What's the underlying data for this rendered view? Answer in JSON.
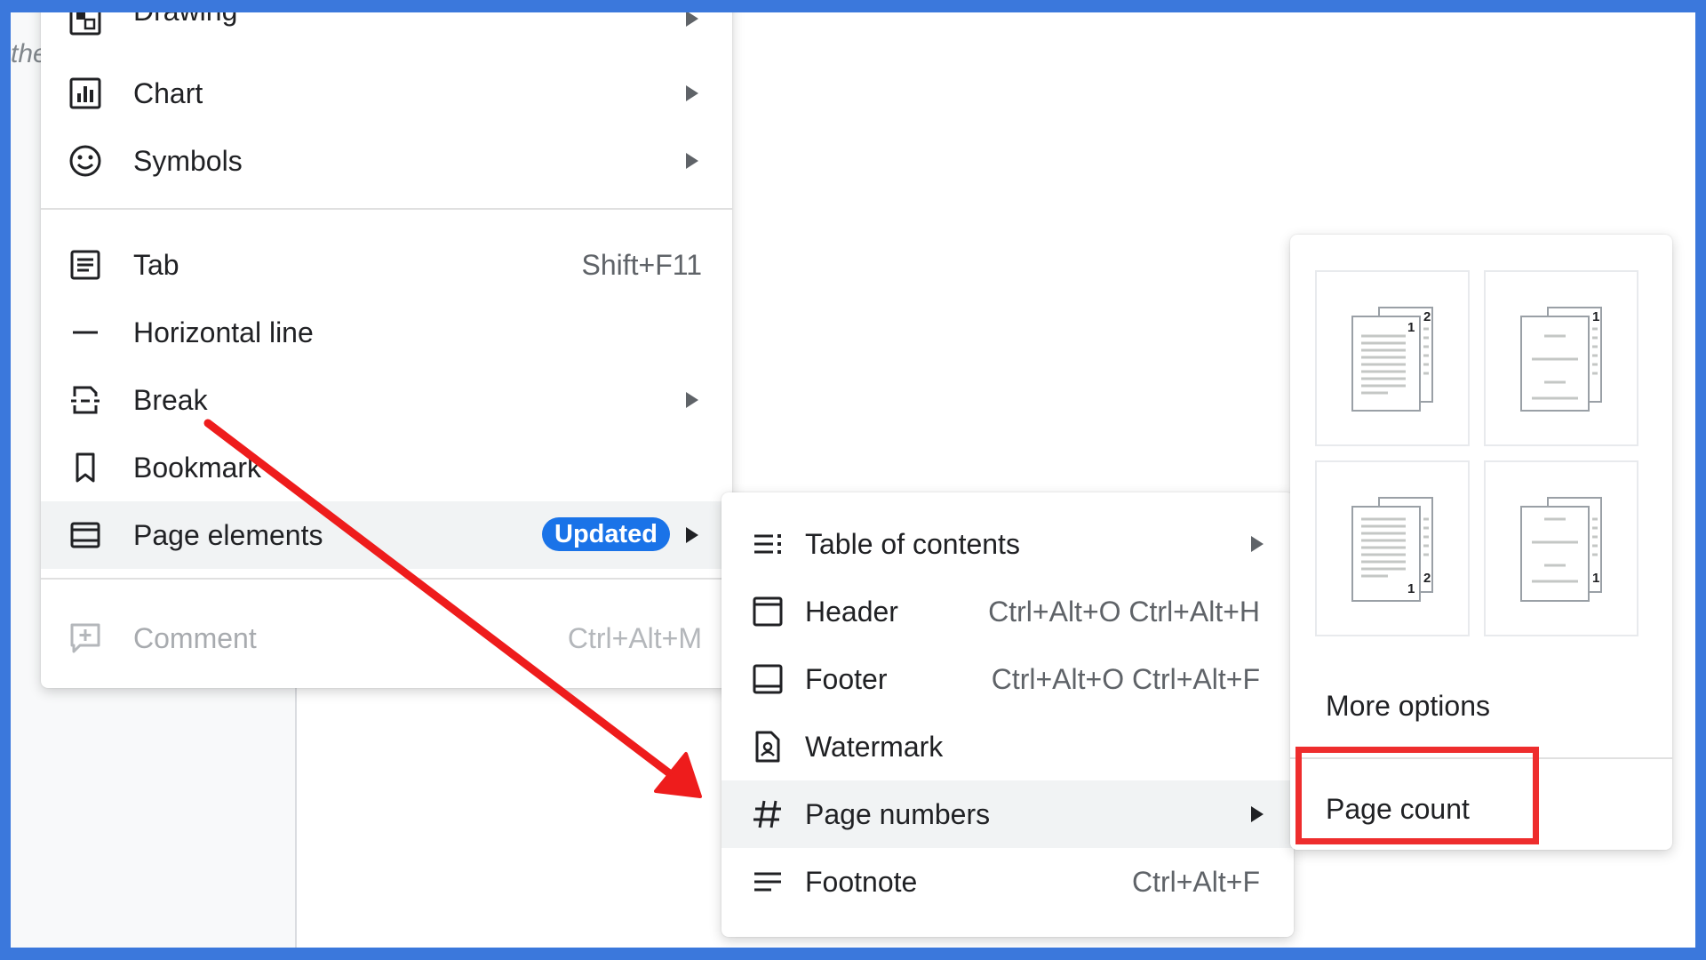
{
  "document": {
    "text_fragment": "the"
  },
  "insert_menu": {
    "items": [
      {
        "label": "Drawing",
        "icon": "drawing-icon",
        "submenu": true
      },
      {
        "label": "Chart",
        "icon": "chart-icon",
        "submenu": true
      },
      {
        "label": "Symbols",
        "icon": "emoji-icon",
        "submenu": true
      },
      {
        "label": "Tab",
        "icon": "tab-icon",
        "shortcut": "Shift+F11"
      },
      {
        "label": "Horizontal line",
        "icon": "horizontal-line-icon"
      },
      {
        "label": "Break",
        "icon": "break-icon",
        "submenu": true
      },
      {
        "label": "Bookmark",
        "icon": "bookmark-icon"
      },
      {
        "label": "Page elements",
        "icon": "page-elements-icon",
        "badge": "Updated",
        "submenu": true,
        "highlighted": true
      },
      {
        "label": "Comment",
        "icon": "comment-icon",
        "shortcut": "Ctrl+Alt+M",
        "disabled": true
      }
    ]
  },
  "page_elements_menu": {
    "items": [
      {
        "label": "Table of contents",
        "icon": "table-of-contents-icon",
        "submenu": true
      },
      {
        "label": "Header",
        "icon": "header-icon",
        "shortcut": "Ctrl+Alt+O Ctrl+Alt+H"
      },
      {
        "label": "Footer",
        "icon": "footer-icon",
        "shortcut": "Ctrl+Alt+O Ctrl+Alt+F"
      },
      {
        "label": "Watermark",
        "icon": "watermark-icon"
      },
      {
        "label": "Page numbers",
        "icon": "hash-icon",
        "submenu": true,
        "highlighted": true
      },
      {
        "label": "Footnote",
        "icon": "footnote-icon",
        "shortcut": "Ctrl+Alt+F"
      }
    ]
  },
  "page_numbers_menu": {
    "thumbnails": [
      {
        "name": "top-right-all-pages",
        "labels": [
          "1",
          "2"
        ]
      },
      {
        "name": "top-right-skip-first",
        "labels": [
          "1"
        ]
      },
      {
        "name": "bottom-right-all-pages",
        "labels": [
          "1",
          "2"
        ]
      },
      {
        "name": "bottom-right-skip-first",
        "labels": [
          "1"
        ]
      }
    ],
    "more_options": "More options",
    "page_count": "Page count"
  },
  "annotations": {
    "arrow_color": "#ee1c1c",
    "box_color": "#ee2d2d"
  },
  "colors": {
    "frame": "#3b78dc",
    "badge": "#1a73e8",
    "highlight": "#f1f3f4"
  }
}
